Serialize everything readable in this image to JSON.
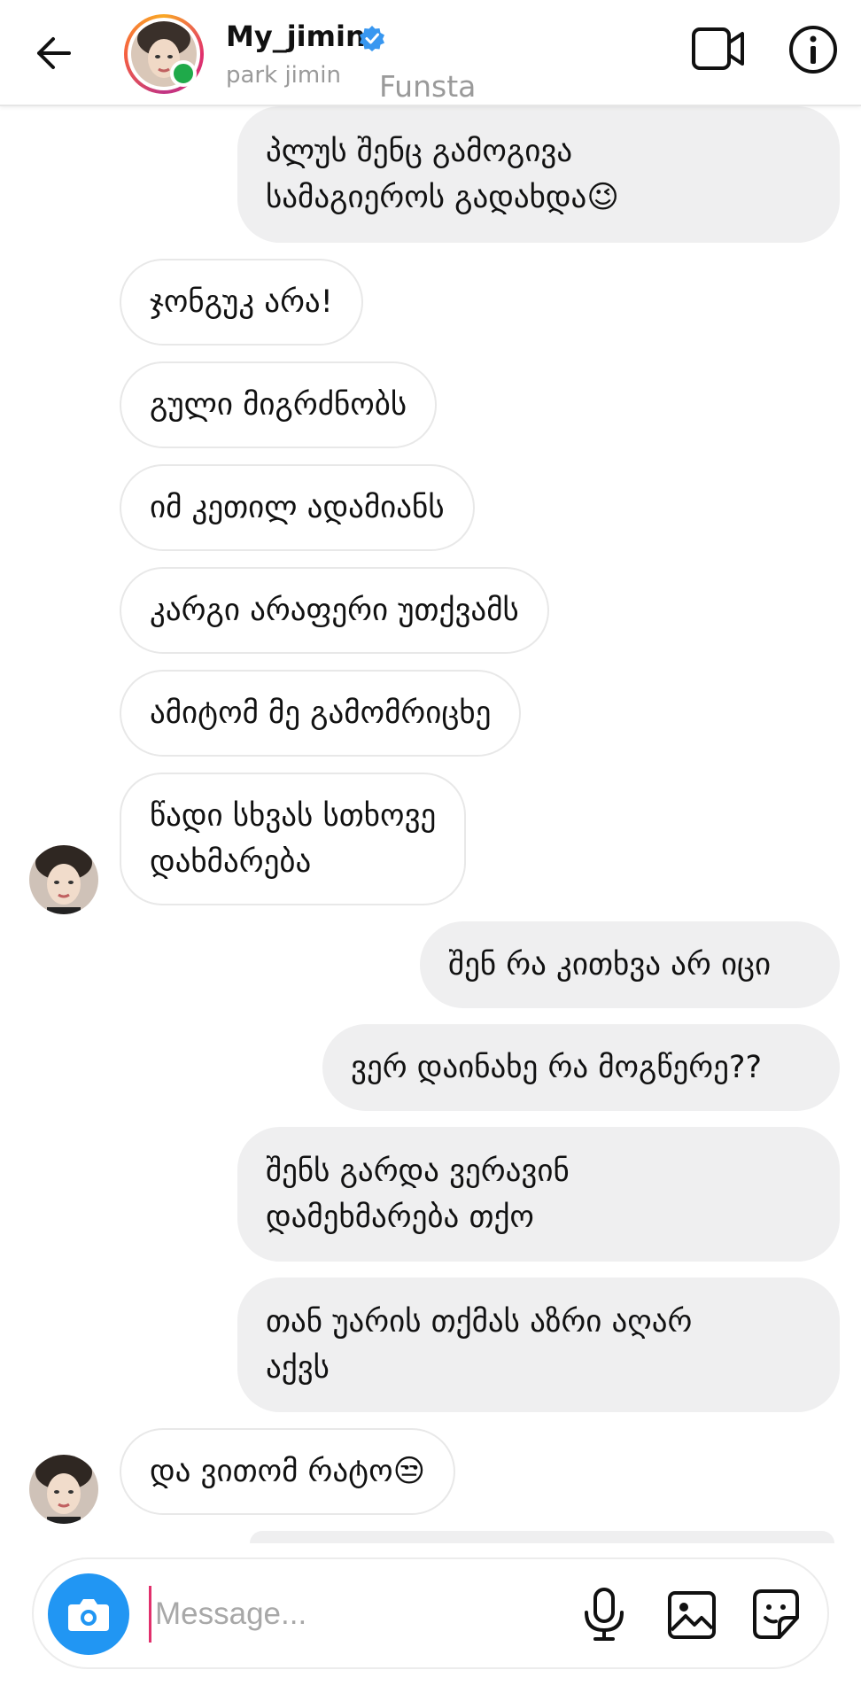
{
  "header": {
    "username": "My_jimin",
    "subname": "park jimin",
    "overlay_text": "Funsta"
  },
  "messages": [
    {
      "side": "out",
      "lines": [
        "პლუს შენც გამოგივა",
        "სამაგიეროს გადახდა😉"
      ]
    },
    {
      "side": "in",
      "lines": [
        "ჯონგუკ არა!"
      ]
    },
    {
      "side": "in",
      "lines": [
        "გული მიგრძნობს"
      ]
    },
    {
      "side": "in",
      "lines": [
        "იმ კეთილ ადამიანს"
      ]
    },
    {
      "side": "in",
      "lines": [
        "კარგი არაფერი უთქვამს"
      ]
    },
    {
      "side": "in",
      "lines": [
        "ამიტომ მე გამომრიცხე"
      ]
    },
    {
      "side": "in",
      "lines": [
        "წადი სხვას სთხოვე",
        "დახმარება"
      ]
    },
    {
      "side": "out",
      "lines": [
        "შენ რა კითხვა არ იცი"
      ]
    },
    {
      "side": "out",
      "lines": [
        "ვერ დაინახე რა მოგწერე??"
      ]
    },
    {
      "side": "out",
      "lines": [
        "შენს გარდა ვერავინ",
        "დამეხმარება თქო"
      ]
    },
    {
      "side": "out",
      "lines": [
        "თან უარის თქმას აზრი აღარ",
        "აქვს"
      ]
    },
    {
      "side": "in",
      "lines": [
        "და ვითომ რატო😒"
      ]
    }
  ],
  "composer": {
    "placeholder": "Message..."
  },
  "icons": {
    "back": "arrow-left-icon",
    "video": "video-call-icon",
    "info": "info-icon",
    "camera": "camera-icon",
    "mic": "microphone-icon",
    "gallery": "image-icon",
    "sticker": "sticker-icon",
    "verified": "verified-badge-icon"
  },
  "colors": {
    "accent_blue": "#2196f3",
    "verified_blue": "#3897f0",
    "online_green": "#1faa4a",
    "outgoing_bubble": "#efeff0"
  }
}
